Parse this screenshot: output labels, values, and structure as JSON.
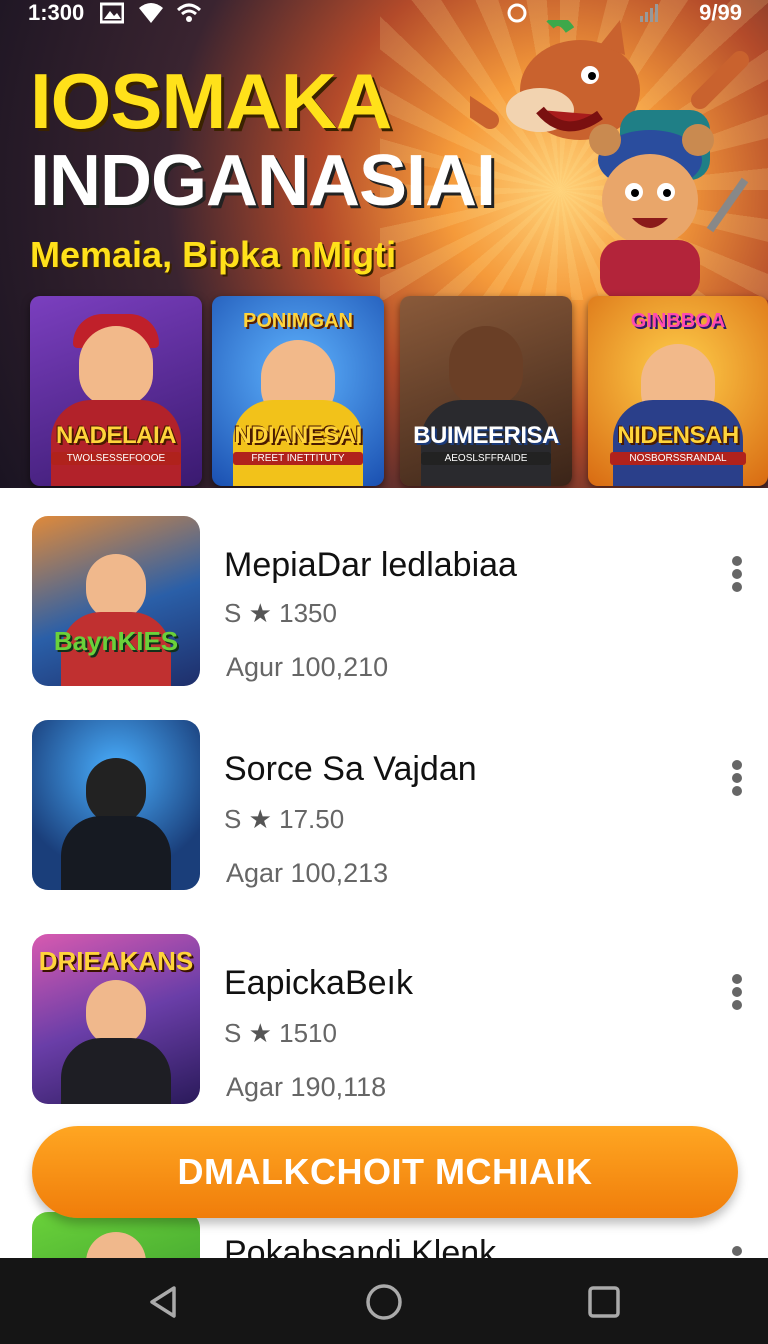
{
  "status_bar": {
    "time": "1:300",
    "battery_text": "9/99",
    "icons": [
      "image-icon",
      "wifi-icon",
      "signal-icon",
      "circle-icon",
      "battery-icon"
    ]
  },
  "hero": {
    "title_line1": "IOSMAKA",
    "title_line2": "INDGANASIAI",
    "subtitle": "Memaia, Bipka nMigti",
    "cards": [
      {
        "label": "NADELAIA",
        "sublabel": "TWOLSESSEFOOOE",
        "toplabel": ""
      },
      {
        "label": "NDIANESAI",
        "sublabel": "FREET INETTITUTY",
        "toplabel": "PONIMGAN"
      },
      {
        "label": "BUIMEERISA",
        "sublabel": "AEOSLSFFRAIDE",
        "toplabel": ""
      },
      {
        "label": "NIDENSAH",
        "sublabel": "NOSBORSSRANDAL",
        "toplabel": "GINBBOA"
      }
    ]
  },
  "apps": [
    {
      "name": "MepiaDar ledlabiaa",
      "rating_prefix": "S",
      "rating": "1350",
      "meta": "Agur 100,210",
      "thumb_label": "BaynKIES",
      "thumb_color": "#2a5fa8"
    },
    {
      "name": "Sorce Sa Vajdan",
      "rating_prefix": "S",
      "rating": "17.50",
      "meta": "Agar 100,213",
      "thumb_label": "",
      "thumb_color": "#1f4a86"
    },
    {
      "name": "EapickaBeık",
      "rating_prefix": "S",
      "rating": "1510",
      "meta": "Agar 190,118",
      "thumb_label": "DRIEAKANS",
      "thumb_color": "#6a3ea8"
    },
    {
      "name": "Pokabsandi Klenk",
      "rating_prefix": "",
      "rating": "",
      "meta": "",
      "thumb_label": "",
      "thumb_color": "#3aa23a"
    }
  ],
  "cta": {
    "label": "DMALKCHOIT MCHIAIK"
  },
  "nav": {
    "back": "back-icon",
    "home": "home-icon",
    "recents": "recents-icon"
  },
  "colors": {
    "accent_orange": "#f58a10",
    "title_yellow": "#ffe11a",
    "nav_bg": "#151515"
  }
}
